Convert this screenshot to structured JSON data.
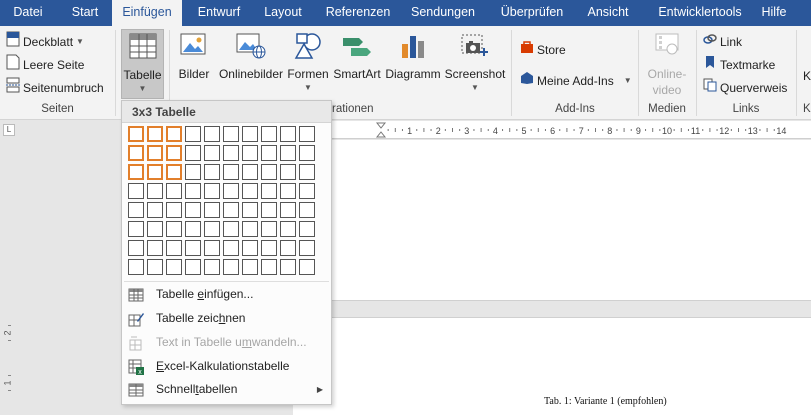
{
  "tabs": [
    {
      "label": "Datei",
      "active": false
    },
    {
      "label": "Start",
      "active": false
    },
    {
      "label": "Einfügen",
      "active": true
    },
    {
      "label": "Entwurf",
      "active": false
    },
    {
      "label": "Layout",
      "active": false
    },
    {
      "label": "Referenzen",
      "active": false
    },
    {
      "label": "Sendungen",
      "active": false
    },
    {
      "label": "Überprüfen",
      "active": false
    },
    {
      "label": "Ansicht",
      "active": false
    },
    {
      "label": "Entwicklertools",
      "active": false
    },
    {
      "label": "Hilfe",
      "active": false
    }
  ],
  "ribbon": {
    "seiten": {
      "deckblatt": "Deckblatt",
      "leere_seite": "Leere Seite",
      "seitenumbruch": "Seitenumbruch",
      "label": "Seiten"
    },
    "tabelle": {
      "label": "Tabelle"
    },
    "illustrationen": {
      "bilder": "Bilder",
      "onlinebilder": "Onlinebilder",
      "formen": "Formen",
      "smartart": "SmartArt",
      "diagramm": "Diagramm",
      "screenshot": "Screenshot",
      "label_partial": "rationen"
    },
    "addins": {
      "store": "Store",
      "meine_addins": "Meine Add-Ins",
      "label": "Add-Ins"
    },
    "medien": {
      "online_video_1": "Online-",
      "online_video_2": "video",
      "label": "Medien"
    },
    "links": {
      "link": "Link",
      "textmarke": "Textmarke",
      "querverweis": "Querverweis",
      "label": "Links"
    },
    "cut_k1": "K",
    "cut_k2": "K"
  },
  "table_dropdown": {
    "header": "3x3 Tabelle",
    "grid": {
      "cols": 10,
      "rows": 8,
      "selected_cols": 3,
      "selected_rows": 3
    },
    "items": {
      "einfuegen": {
        "before": "Tabelle ",
        "accel": "e",
        "after": "infügen..."
      },
      "zeichnen": {
        "before": "Tabelle zeic",
        "accel": "h",
        "after": "nen"
      },
      "umwandeln": {
        "before": "Text in Tabelle u",
        "accel": "m",
        "after": "wandeln..."
      },
      "excel": {
        "before": "",
        "accel": "E",
        "after": "xcel-Kalkulationstabelle"
      },
      "schnell": {
        "before": "Schnell",
        "accel": "t",
        "after": "abellen"
      }
    }
  },
  "ruler": {
    "numbers": [
      "1",
      "2",
      "3",
      "4",
      "5",
      "6",
      "7",
      "8",
      "9",
      "10",
      "11",
      "12",
      "13",
      "14"
    ],
    "vertical": [
      "1",
      "2"
    ]
  },
  "document": {
    "caption": "Tab. 1: Variante 1 (empfohlen)"
  }
}
